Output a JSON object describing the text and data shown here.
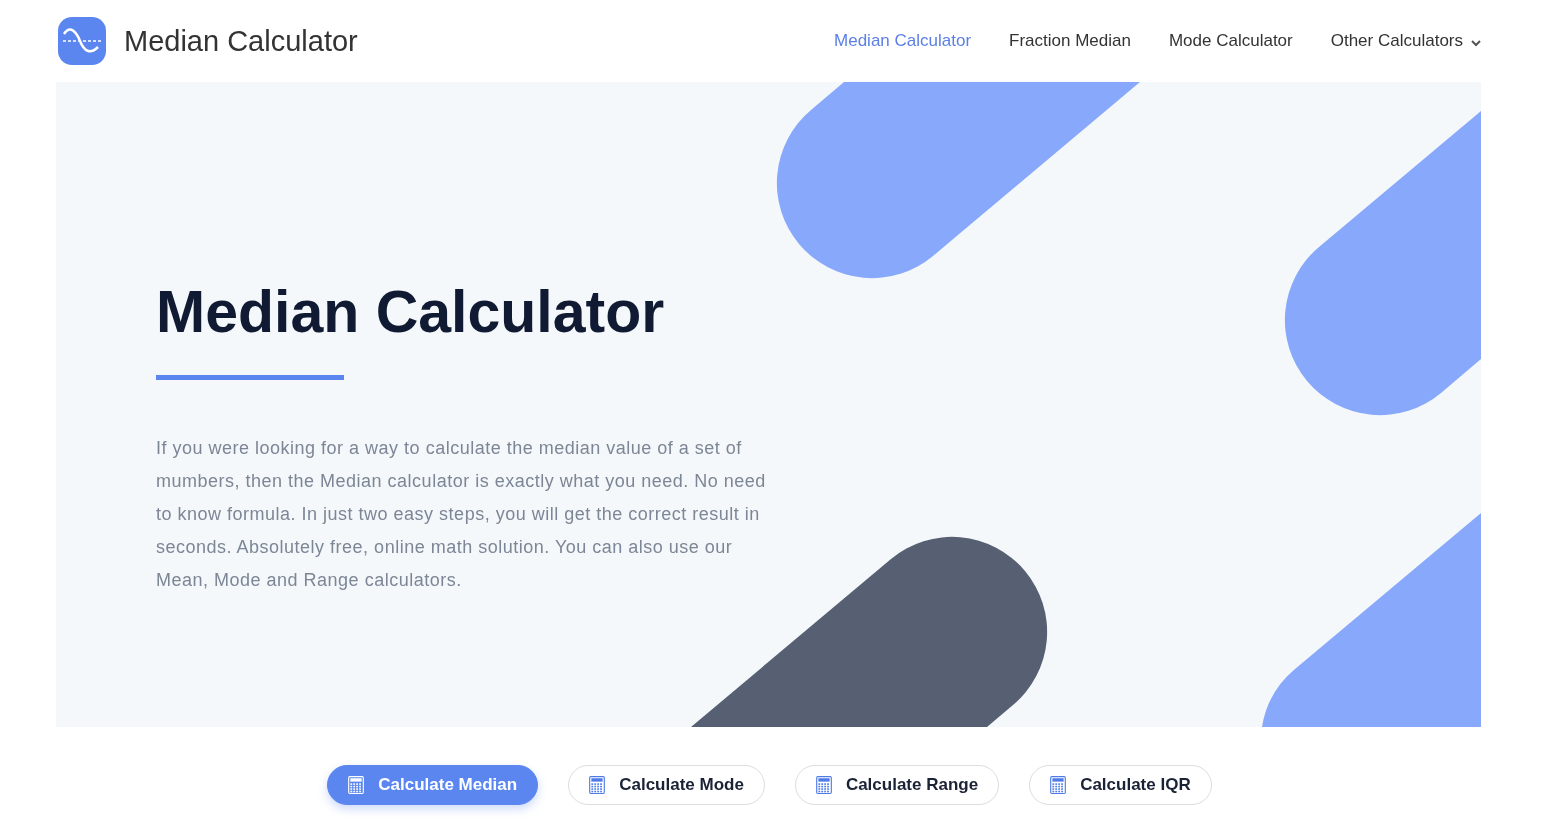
{
  "header": {
    "logo_text": "Median Calculator"
  },
  "nav": [
    {
      "label": "Median Calculator",
      "selected": true,
      "dropdown": false
    },
    {
      "label": "Fraction Median",
      "selected": false,
      "dropdown": false
    },
    {
      "label": "Mode Calculator",
      "selected": false,
      "dropdown": false
    },
    {
      "label": "Other Calculators",
      "selected": false,
      "dropdown": true
    }
  ],
  "hero": {
    "title": "Median Calculator",
    "text": "If you were looking for a way to calculate the median value of a set of mumbers, then the Median calculator is exactly what you need. No need to know formula. In just two easy steps, you will get the correct result in seconds. Absolutely free, online math solution. You can also use our Mean, Mode and Range calculators."
  },
  "buttons": [
    {
      "label": "Calculate Median",
      "selected": true
    },
    {
      "label": "Calculate Mode",
      "selected": false
    },
    {
      "label": "Calculate Range",
      "selected": false
    },
    {
      "label": "Calculate IQR",
      "selected": false
    }
  ]
}
